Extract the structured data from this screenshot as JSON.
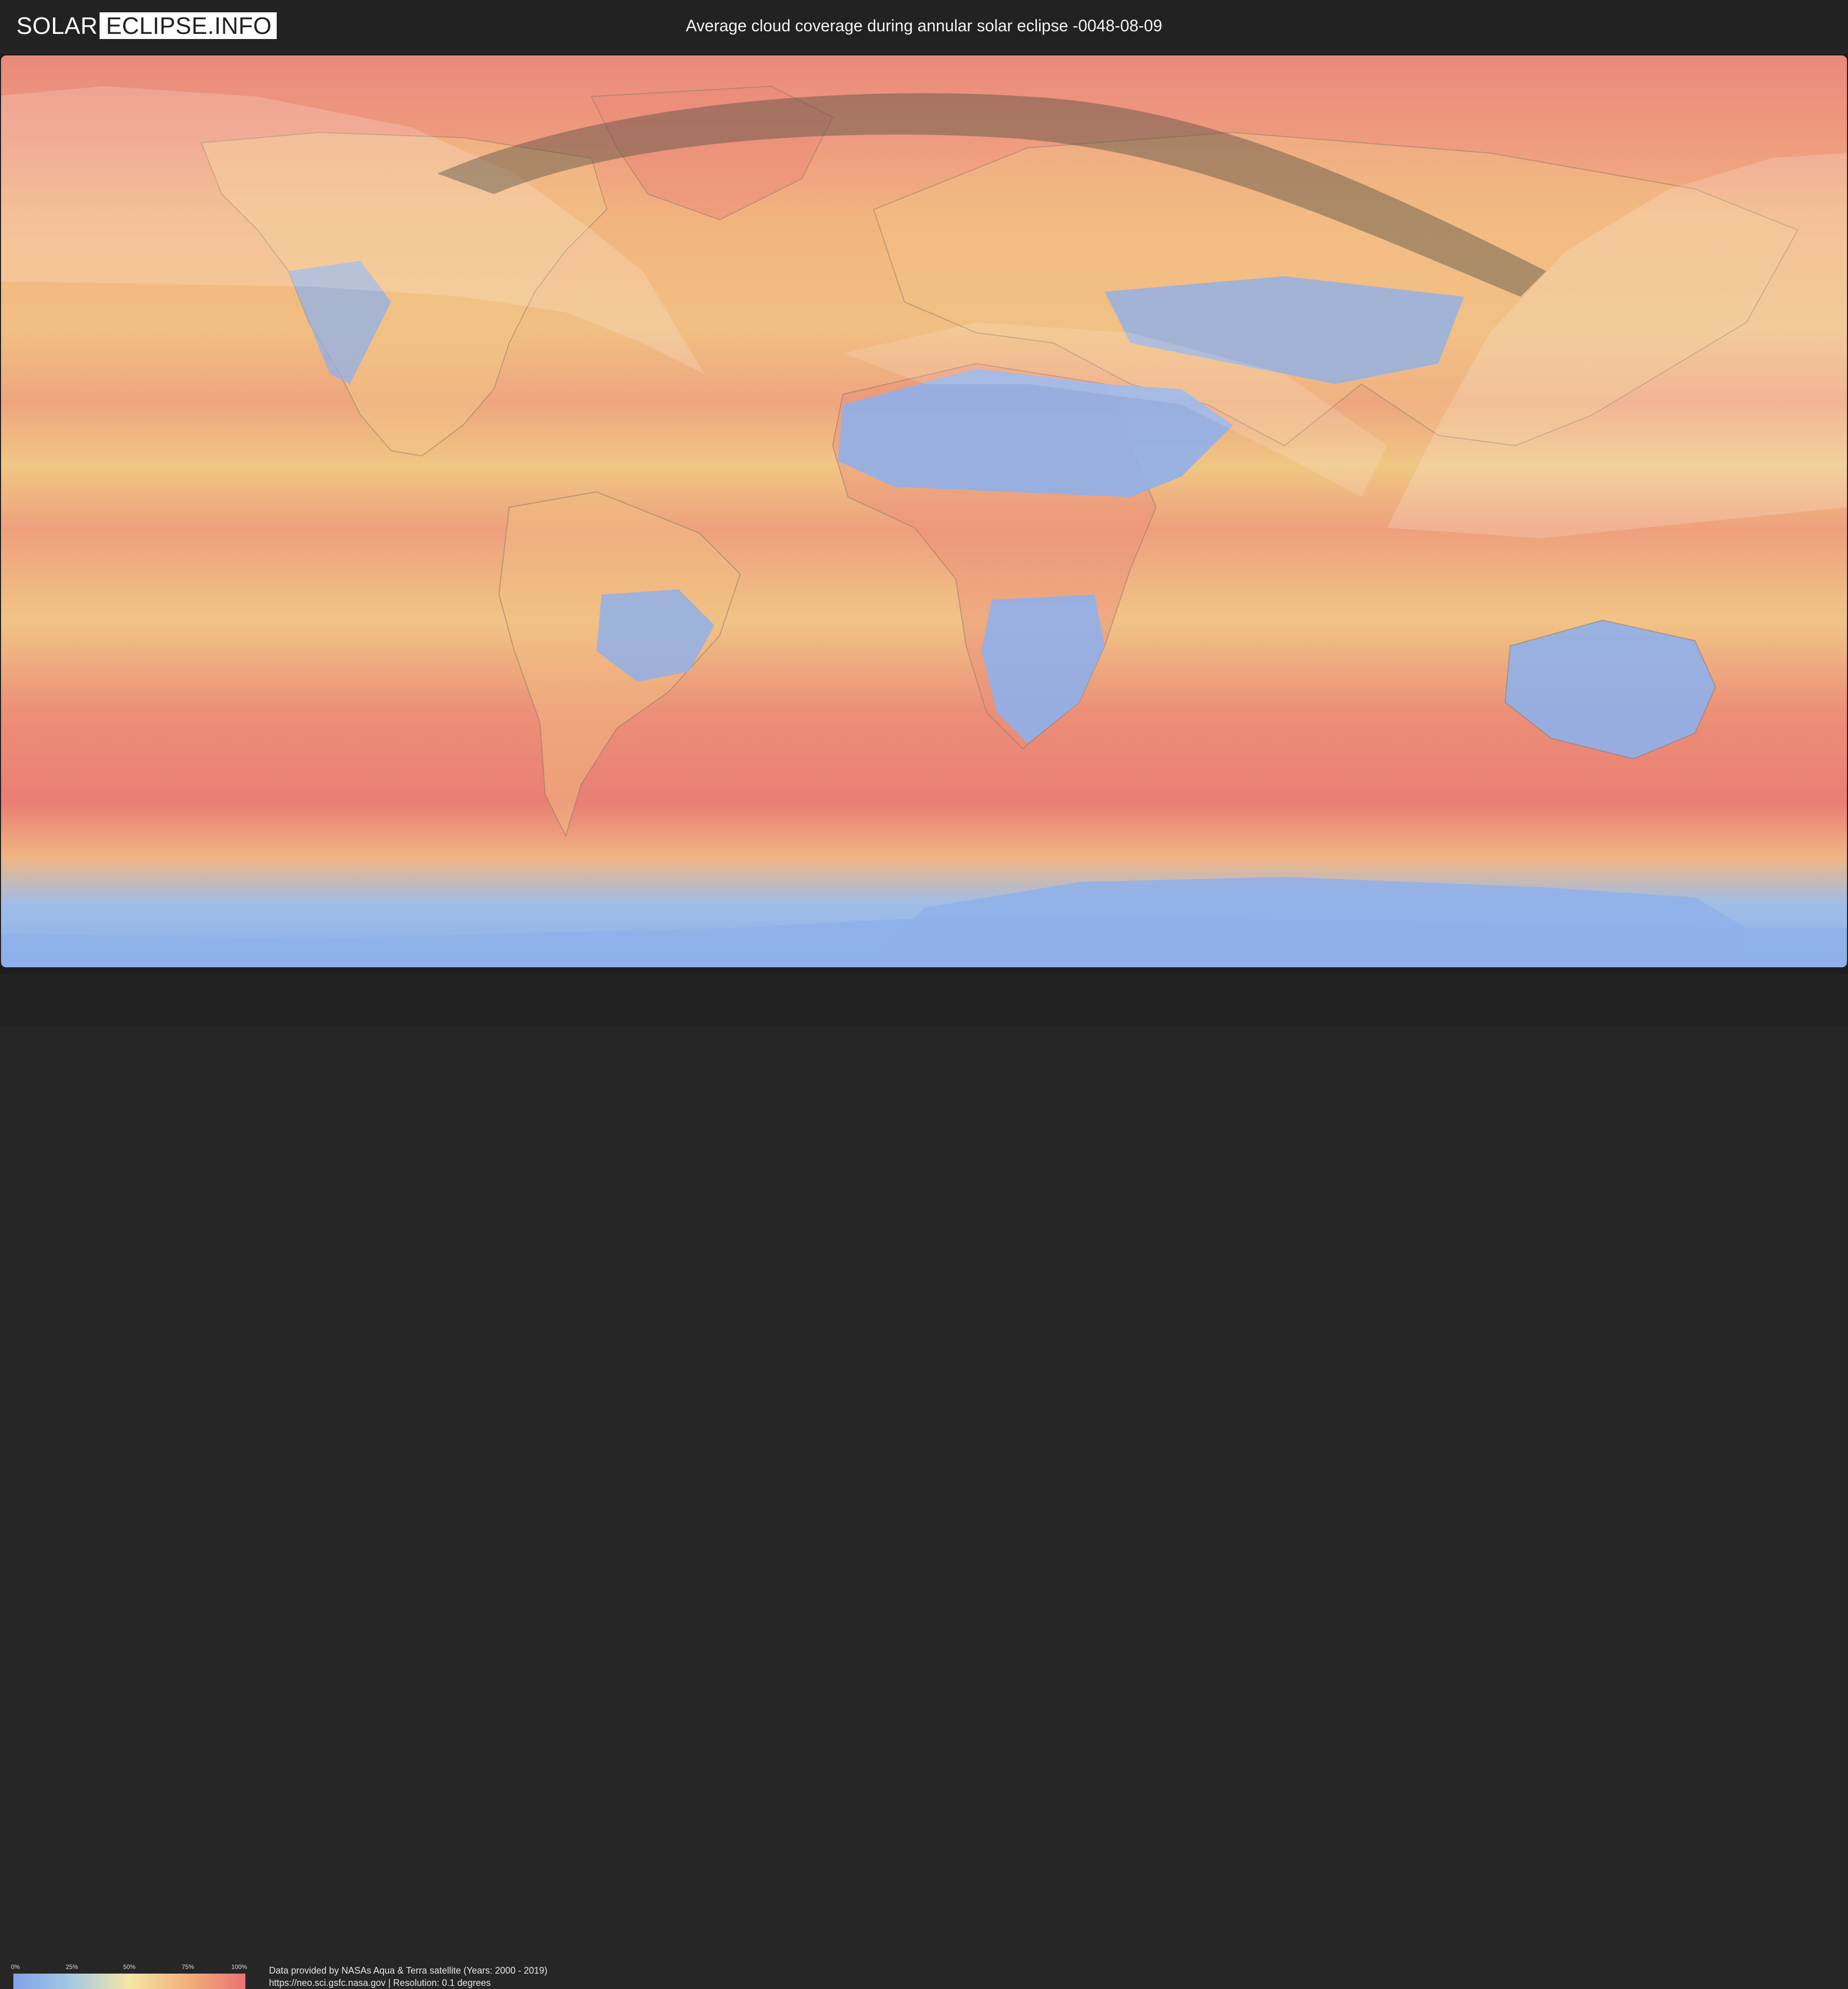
{
  "header": {
    "logo_left": "SOLAR",
    "logo_right": "ECLIPSE.INFO",
    "title": "Average cloud coverage during annular solar eclipse -0048-08-09"
  },
  "legend": {
    "ticks": [
      "0%",
      "25%",
      "50%",
      "75%",
      "100%"
    ],
    "color_low": "#7fa2ea",
    "color_mid": "#f3e7a3",
    "color_high": "#ea7373"
  },
  "footer": {
    "source": "Data provided by NASAs Aqua & Terra satellite (Years: 2000 - 2019)",
    "url_line": "https://neo.sci.gsfc.nasa.gov | Resolution: 0.1 degrees"
  }
}
